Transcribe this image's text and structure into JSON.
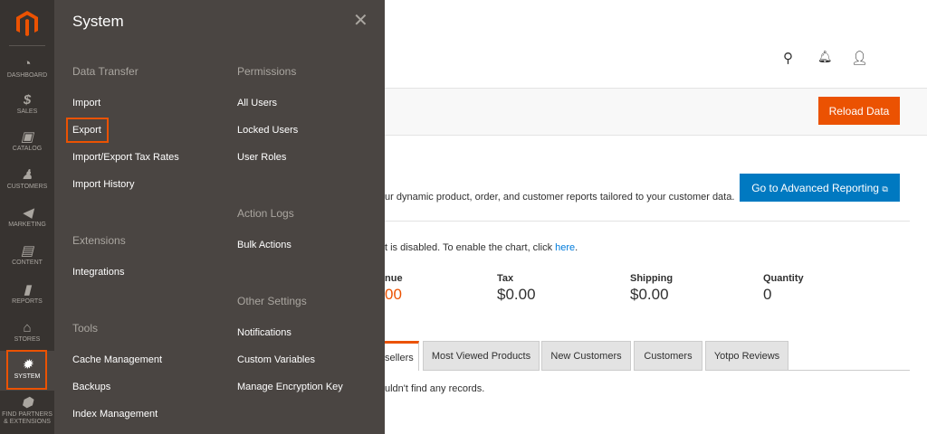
{
  "sidebar": {
    "items": [
      {
        "label": "Dashboard",
        "icon": "dashboard-icon"
      },
      {
        "label": "Sales",
        "icon": "dollar-icon"
      },
      {
        "label": "Catalog",
        "icon": "box-icon"
      },
      {
        "label": "Customers",
        "icon": "person-icon"
      },
      {
        "label": "Marketing",
        "icon": "megaphone-icon"
      },
      {
        "label": "Content",
        "icon": "layout-icon"
      },
      {
        "label": "Reports",
        "icon": "bar-chart-icon"
      },
      {
        "label": "Stores",
        "icon": "store-icon"
      },
      {
        "label": "System",
        "icon": "gear-icon",
        "active": true
      },
      {
        "label": "Find Partners & Extensions",
        "icon": "extensions-icon"
      }
    ]
  },
  "flyout": {
    "title": "System",
    "groups": {
      "data_transfer": "Data Transfer",
      "extensions": "Extensions",
      "tools": "Tools",
      "permissions": "Permissions",
      "action_logs": "Action Logs",
      "other_settings": "Other Settings"
    },
    "items": {
      "import": "Import",
      "export": "Export",
      "tax_rates": "Import/Export Tax Rates",
      "import_history": "Import History",
      "integrations": "Integrations",
      "cache": "Cache Management",
      "backups": "Backups",
      "index": "Index Management",
      "all_users": "All Users",
      "locked_users": "Locked Users",
      "user_roles": "User Roles",
      "bulk_actions": "Bulk Actions",
      "notifications": "Notifications",
      "custom_variables": "Custom Variables",
      "encryption": "Manage Encryption Key"
    }
  },
  "header": {
    "reload": "Reload Data"
  },
  "reporting": {
    "text": "ur dynamic product, order, and customer reports tailored to your customer data.",
    "button": "Go to Advanced Reporting"
  },
  "chart_notice": {
    "text": "t is disabled. To enable the chart, click ",
    "link": "here",
    "end": "."
  },
  "totals": [
    {
      "label": "nue",
      "value": "00"
    },
    {
      "label": "Tax",
      "value": "$0.00"
    },
    {
      "label": "Shipping",
      "value": "$0.00"
    },
    {
      "label": "Quantity",
      "value": "0"
    }
  ],
  "tabs": [
    "sellers",
    "Most Viewed Products",
    "New Customers",
    "Customers",
    "Yotpo Reviews"
  ],
  "empty": "uldn't find any records.",
  "colors": {
    "accent": "#eb5202",
    "primary": "#0079c1",
    "sidebar": "#373330",
    "flyout": "#4a4542"
  }
}
